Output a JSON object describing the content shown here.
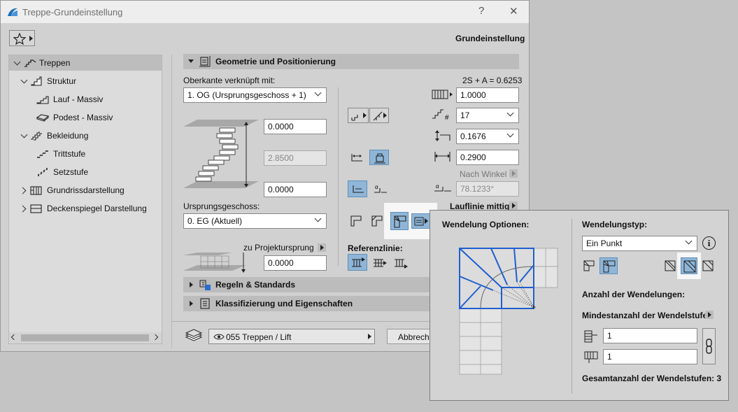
{
  "window": {
    "title": "Treppe-Grundeinstellung",
    "help_glyph": "?",
    "close_glyph": "✕",
    "header_right": "Grundeinstellung"
  },
  "tree": {
    "items": [
      {
        "label": "Treppen",
        "icon": "stair-icon"
      },
      {
        "label": "Struktur",
        "icon": "structure-icon"
      },
      {
        "label": "Lauf - Massiv",
        "icon": "flight-icon"
      },
      {
        "label": "Podest - Massiv",
        "icon": "landing-icon"
      },
      {
        "label": "Bekleidung",
        "icon": "finish-icon"
      },
      {
        "label": "Trittstufe",
        "icon": "tread-icon"
      },
      {
        "label": "Setzstufe",
        "icon": "riser-icon"
      },
      {
        "label": "Grundrissdarstellung",
        "icon": "floorplan-icon"
      },
      {
        "label": "Deckenspiegel Darstellung",
        "icon": "ceiling-plan-icon"
      }
    ]
  },
  "geometry": {
    "section_title": "Geometrie und Positionierung",
    "top_link_label": "Oberkante verknüpft mit:",
    "top_link_value": "1. OG (Ursprungsgeschoss + 1)",
    "formula": "2S + A = 0.6253",
    "top_offset": "0.0000",
    "height": "2.8500",
    "bottom_offset": "0.0000",
    "home_story_label": "Ursprungsgeschoss:",
    "home_story_value": "0. EG (Aktuell)",
    "project_origin_label": "zu Projektursprung",
    "project_origin_value": "0.0000",
    "flight_width": "1.0000",
    "riser_count": "17",
    "riser_height": "0.1676",
    "tread_depth": "0.2900",
    "angle_mode_label": "Nach Winkel",
    "angle_value": "78.1233°",
    "walking_line_label": "Lauflinie mittig",
    "reference_line_label": "Referenzlinie:"
  },
  "sections": {
    "rules": "Regeln & Standards",
    "classification": "Klassifizierung und Eigenschaften"
  },
  "footer": {
    "layer": "055 Treppen / Lift",
    "cancel": "Abbrechen"
  },
  "popup": {
    "options_title": "Wendelung Optionen:",
    "type_label": "Wendelungstyp:",
    "type_value": "Ein Punkt",
    "info_glyph": "i",
    "winder_count_label": "Anzahl der Wendelungen:",
    "min_winders_label": "Mindestanzahl der Wendelstufen",
    "min_first": "1",
    "min_second": "1",
    "total_label": "Gesamtanzahl der Wendelstufen: 3"
  },
  "colors": {
    "accent_blue": "#1f5fd0",
    "toggle_on": "#8fb6d8",
    "panel_bg": "#d1d1d1"
  }
}
